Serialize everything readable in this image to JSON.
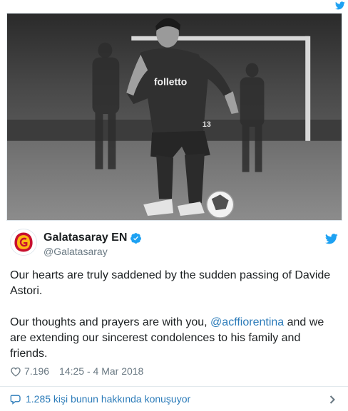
{
  "tweet": {
    "photo": {
      "shirt_text": "folletto",
      "kit_number": "13"
    },
    "author": {
      "display_name": "Galatasaray EN",
      "handle": "@Galatasaray",
      "verified": true,
      "avatar_icon": "galatasaray-crest-icon"
    },
    "text": {
      "paragraph_1": "Our hearts are truly saddened by the sudden passing of Davide Astori.",
      "paragraph_2_before": "Our thoughts and prayers are with you, ",
      "mention": "@acffiorentina",
      "paragraph_2_after": " and we are extending our sincerest condolences to his family and friends."
    },
    "likes": "7.196",
    "timestamp": "14:25 - 4 Mar 2018",
    "conversation_label": "1.285 kişi bunun hakkında konuşuyor"
  },
  "icons": {
    "brand": "twitter-bird-icon",
    "verified": "verified-badge-icon",
    "like": "heart-icon",
    "conversation": "speech-bubble-icon",
    "expand": "chevron-right-icon"
  },
  "colors": {
    "link": "#2b7bb9",
    "twitter_blue": "#1da1f2",
    "muted": "#697882",
    "crest_red": "#c8102e",
    "crest_yellow": "#fdb912"
  }
}
